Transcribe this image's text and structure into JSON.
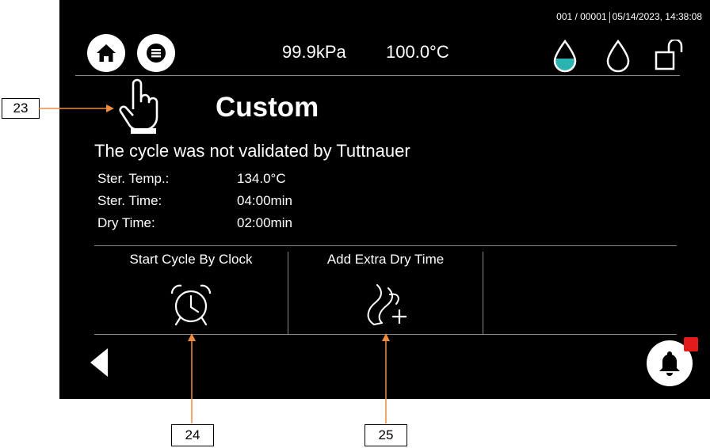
{
  "status_bar": {
    "counter": "001 / 00001",
    "datetime": "05/14/2023, 14:38:08"
  },
  "header": {
    "pressure": "99.9kPa",
    "temperature": "100.0°C"
  },
  "cycle": {
    "title": "Custom",
    "message": "The cycle was not validated by Tuttnauer",
    "params": [
      {
        "label": "Ster. Temp.:",
        "value": "134.0°C"
      },
      {
        "label": "Ster. Time:",
        "value": "04:00min"
      },
      {
        "label": "Dry Time:",
        "value": "02:00min"
      }
    ]
  },
  "options": [
    {
      "label": "Start Cycle By Clock",
      "icon": "alarm-clock-icon"
    },
    {
      "label": "Add Extra Dry Time",
      "icon": "steam-plus-icon"
    }
  ],
  "callouts": [
    "23",
    "24",
    "25"
  ],
  "colors": {
    "background": "#000000",
    "water_fill": "#2bb3b1",
    "callout_arrow": "#f08a3c",
    "badge": "#e31b1b"
  }
}
